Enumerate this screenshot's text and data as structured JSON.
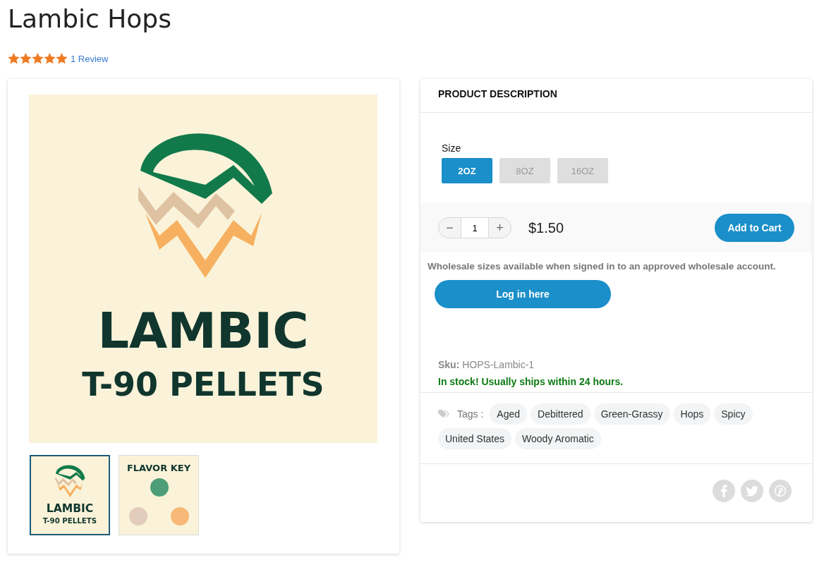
{
  "title": "Lambic Hops",
  "rating": {
    "stars": 5,
    "reviews": "1 Review"
  },
  "gallery": {
    "main": {
      "kind": "label",
      "line_1": "LAMBIC",
      "line_2": "T-90 PELLETS"
    },
    "thumbnails": [
      {
        "kind": "label",
        "selected": true,
        "line_1": "LAMBIC",
        "line_2": "T-90 PELLETS"
      },
      {
        "kind": "flavor-key",
        "selected": false,
        "heading": "FLAVOR KEY"
      }
    ]
  },
  "description": {
    "heading": "PRODUCT DESCRIPTION",
    "size_label": "Size",
    "sizes": [
      {
        "label": "2OZ",
        "selected": true
      },
      {
        "label": "8OZ",
        "selected": false
      },
      {
        "label": "16OZ",
        "selected": false
      }
    ],
    "quantity": "1",
    "minus": "−",
    "plus": "+",
    "price": "$1.50",
    "add_to_cart": "Add to Cart",
    "wholesale_note": "Wholesale sizes available when signed in to an approved wholesale account.",
    "login_button": "Log in here",
    "sku_label": "Sku:",
    "sku": "HOPS-Lambic-1",
    "stock": "In stock! Usually ships within 24 hours.",
    "tags_label": "Tags :",
    "tags": [
      "Aged",
      "Debittered",
      "Green-Grassy",
      "Hops",
      "Spicy",
      "United States",
      "Woody Aromatic"
    ]
  }
}
